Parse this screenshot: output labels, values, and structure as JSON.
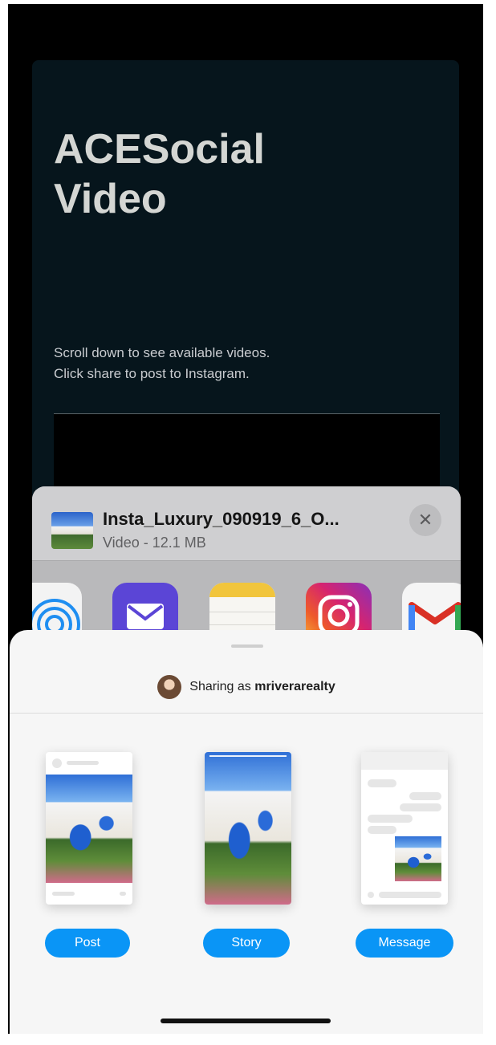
{
  "page": {
    "title": "ACESocial Video",
    "description_line1": "Scroll down to see available videos.",
    "description_line2": "Click share to post to Instagram."
  },
  "share_sheet": {
    "file_name": "Insta_Luxury_090919_6_O...",
    "file_meta": "Video - 12.1 MB",
    "close_symbol": "✕",
    "apps": [
      {
        "icon": "airdrop-icon"
      },
      {
        "icon": "mail-icon"
      },
      {
        "icon": "notes-icon"
      },
      {
        "icon": "instagram-icon"
      },
      {
        "icon": "gmail-icon"
      }
    ]
  },
  "instagram_sheet": {
    "sharing_prefix": "Sharing as",
    "username": "mriverarealty",
    "options": [
      {
        "label": "Post"
      },
      {
        "label": "Story"
      },
      {
        "label": "Message"
      }
    ]
  },
  "colors": {
    "page_background": "#06151c",
    "instagram_blue": "#0a95f6",
    "mail_purple": "#5b45d6"
  }
}
